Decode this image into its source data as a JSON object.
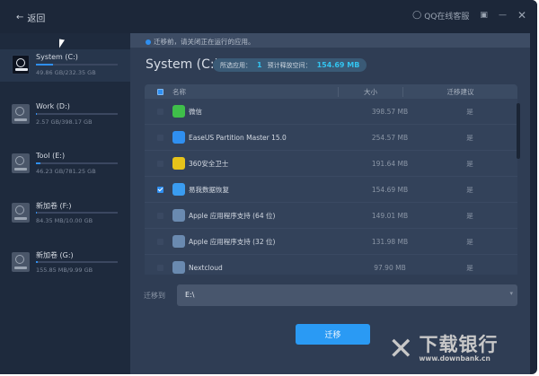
{
  "titlebar": {
    "back_label": "返回",
    "qq_label": "QQ在线客服"
  },
  "sidebar": {
    "drives": [
      {
        "name": "System (C:)",
        "size": "49.86 GB/232.35 GB",
        "used_pct": 21,
        "selected": true
      },
      {
        "name": "Work (D:)",
        "size": "2.57 GB/398.17 GB",
        "used_pct": 1
      },
      {
        "name": "Tool (E:)",
        "size": "46.23 GB/781.25 GB",
        "used_pct": 6
      },
      {
        "name": "新加卷 (F:)",
        "size": "84.35 MB/10.00 GB",
        "used_pct": 1
      },
      {
        "name": "新加卷 (G:)",
        "size": "155.85 MB/9.99 GB",
        "used_pct": 2
      }
    ]
  },
  "main": {
    "notice": "迁移前，请关闭正在运行的应用。",
    "title": "System (C:)",
    "selected_label": "所选应用：",
    "selected_count": "1",
    "space_label": "预计释放空间：",
    "space_value": "154.69 MB",
    "table": {
      "headers": {
        "name": "名称",
        "size": "大小",
        "suggestion": "迁移建议"
      },
      "rows": [
        {
          "name": "微信",
          "size": "398.57 MB",
          "suggestion": "是",
          "checked": false,
          "color": "#3fbf4a"
        },
        {
          "name": "EaseUS Partition Master 15.0",
          "size": "254.57 MB",
          "suggestion": "是",
          "checked": false,
          "color": "#2f8ff0"
        },
        {
          "name": "360安全卫士",
          "size": "191.64 MB",
          "suggestion": "是",
          "checked": false,
          "color": "#e6c31a"
        },
        {
          "name": "易我数据恢复",
          "size": "154.69 MB",
          "suggestion": "是",
          "checked": true,
          "color": "#3a9cf0"
        },
        {
          "name": "Apple 应用程序支持 (64 位)",
          "size": "149.01 MB",
          "suggestion": "是",
          "checked": false,
          "color": "#6a8ab0"
        },
        {
          "name": "Apple 应用程序支持 (32 位)",
          "size": "131.98 MB",
          "suggestion": "是",
          "checked": false,
          "color": "#6a8ab0"
        },
        {
          "name": "Nextcloud",
          "size": "97.90 MB",
          "suggestion": "是",
          "checked": false,
          "color": "#6a8ab0"
        }
      ]
    },
    "migrate_to_label": "迁移到",
    "migrate_to_value": "E:\\",
    "migrate_button": "迁移"
  },
  "watermark": {
    "text": "下载银行",
    "url": "www.downbank.cn"
  }
}
